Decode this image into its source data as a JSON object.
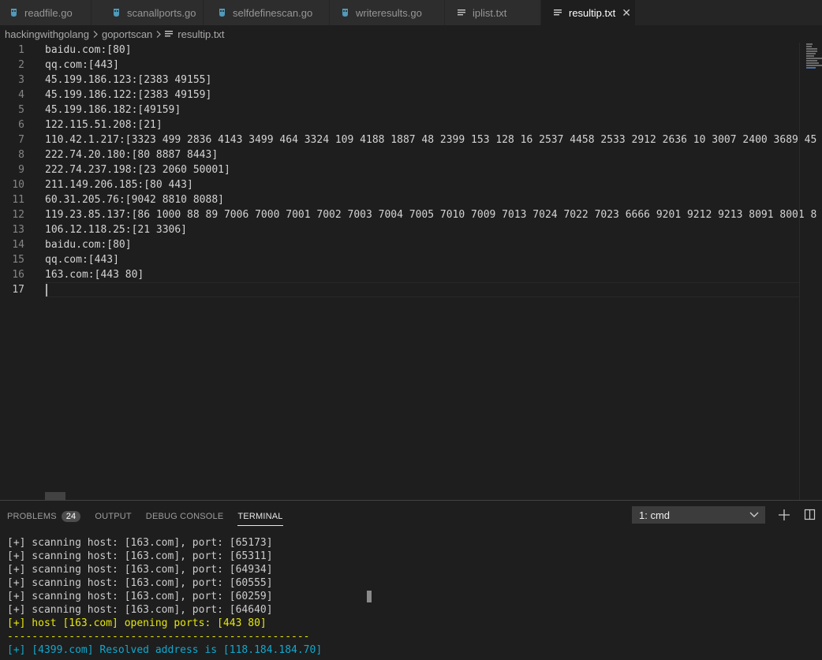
{
  "tabs": [
    {
      "label": "readfile.go",
      "icon": "go-file-icon"
    },
    {
      "label": "scanallports.go",
      "icon": "go-file-icon"
    },
    {
      "label": "selfdefinescan.go",
      "icon": "go-file-icon"
    },
    {
      "label": "writeresults.go",
      "icon": "go-file-icon"
    },
    {
      "label": "iplist.txt",
      "icon": "text-file-icon"
    },
    {
      "label": "resultip.txt",
      "icon": "text-file-icon",
      "close": "✕"
    }
  ],
  "breadcrumb": {
    "items": [
      "hackingwithgolang",
      "goportscan",
      "resultip.txt"
    ]
  },
  "editor": {
    "lines": [
      {
        "num": "1",
        "text": "baidu.com:[80]"
      },
      {
        "num": "2",
        "text": "qq.com:[443]"
      },
      {
        "num": "3",
        "text": "45.199.186.123:[2383 49155]"
      },
      {
        "num": "4",
        "text": "45.199.186.122:[2383 49159]"
      },
      {
        "num": "5",
        "text": "45.199.186.182:[49159]"
      },
      {
        "num": "6",
        "text": "122.115.51.208:[21]"
      },
      {
        "num": "7",
        "text": "110.42.1.217:[3323 499 2836 4143 3499 464 3324 109 4188 1887 48 2399 153 128 16 2537 4458 2533 2912 2636 10 3007 2400 3689 45"
      },
      {
        "num": "8",
        "text": "222.74.20.180:[80 8887 8443]"
      },
      {
        "num": "9",
        "text": "222.74.237.198:[23 2060 50001]"
      },
      {
        "num": "10",
        "text": "211.149.206.185:[80 443]"
      },
      {
        "num": "11",
        "text": "60.31.205.76:[9042 8810 8088]"
      },
      {
        "num": "12",
        "text": "119.23.85.137:[86 1000 88 89 7006 7000 7001 7002 7003 7004 7005 7010 7009 7013 7024 7022 7023 6666 9201 9212 9213 8091 8001 8"
      },
      {
        "num": "13",
        "text": "106.12.118.25:[21 3306]"
      },
      {
        "num": "14",
        "text": "baidu.com:[80]"
      },
      {
        "num": "15",
        "text": "qq.com:[443]"
      },
      {
        "num": "16",
        "text": "163.com:[443 80]"
      },
      {
        "num": "17",
        "text": ""
      }
    ]
  },
  "panel": {
    "tabs": [
      {
        "label": "PROBLEMS",
        "badge": "24"
      },
      {
        "label": "OUTPUT"
      },
      {
        "label": "DEBUG CONSOLE"
      },
      {
        "label": "TERMINAL"
      }
    ],
    "terminal_select": "1: cmd",
    "terminal_lines": [
      {
        "text": "[+] scanning host: [163.com], port: [65173]",
        "style": "normal"
      },
      {
        "text": "[+] scanning host: [163.com], port: [65311]",
        "style": "normal"
      },
      {
        "text": "[+] scanning host: [163.com], port: [64934]",
        "style": "normal"
      },
      {
        "text": "[+] scanning host: [163.com], port: [60555]",
        "style": "normal"
      },
      {
        "text": "[+] scanning host: [163.com], port: [60259]",
        "style": "normal"
      },
      {
        "text": "[+] scanning host: [163.com], port: [64640]",
        "style": "normal"
      },
      {
        "text": "[+] host [163.com] opening ports: [443 80]",
        "style": "yellow"
      },
      {
        "text": "-------------------------------------------------",
        "style": "sep"
      },
      {
        "text": "[+] [4399.com] Resolved address is [118.184.184.70]",
        "style": "cyan"
      }
    ]
  },
  "colors": {
    "editor_bg": "#1e1e1e",
    "tab_inactive": "#2d2d2d",
    "go_icon": "#519aba",
    "terminal_yellow": "#e5e510",
    "terminal_cyan": "#11a8cd"
  }
}
